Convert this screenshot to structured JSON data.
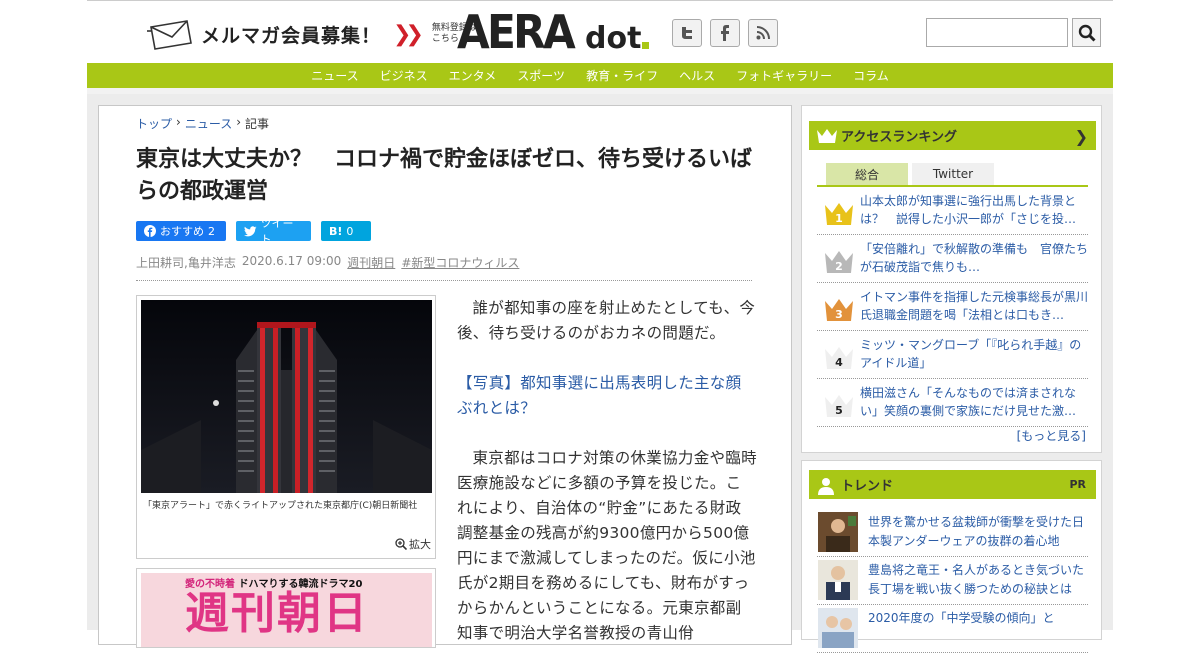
{
  "header": {
    "mailmag_label": "メルマガ会員募集！",
    "free_line1": "無料登録は",
    "free_line2": "こちら",
    "logo_main": "AERA",
    "logo_sub": "dot",
    "social_icons": [
      "twitter-icon",
      "facebook-icon",
      "rss-icon"
    ],
    "search_placeholder": ""
  },
  "nav": [
    "ニュース",
    "ビジネス",
    "エンタメ",
    "スポーツ",
    "教育・ライフ",
    "ヘルス",
    "フォトギャラリー",
    "コラム"
  ],
  "colors": {
    "accent": "#a9c716",
    "link": "#2b5ca6",
    "facebook": "#1877f2",
    "twitter": "#1da1f2",
    "hatena": "#00a4de"
  },
  "breadcrumb": {
    "home": "トップ",
    "section": "ニュース",
    "current": "記事"
  },
  "article": {
    "title": "東京は大丈夫か？　コロナ禍で貯金ほぼゼロ、待ち受けるいばらの都政運営",
    "share_fb_label": "おすすめ",
    "share_fb_count": "2",
    "share_tw_label": "ツイート",
    "share_hb_label": "B!",
    "share_hb_count": "0",
    "authors": "上田耕司,亀井洋志",
    "date": "2020.6.17 09:00",
    "source": "週刊朝日",
    "tag": "#新型コロナウィルス",
    "photo_caption": "「東京アラート」で赤くライトアップされた東京都庁(C)朝日新聞社",
    "zoom_label": "拡大",
    "magazine_top": "愛の不時着",
    "magazine_top2": "ドハマりする韓流ドラマ20",
    "magazine_title": "週刊朝日",
    "para1": "誰が都知事の座を射止めたとしても、今後、待ち受けるのがおカネの問題だ。",
    "photo_link": "【写真】都知事選に出馬表明した主な顔ぶれとは？",
    "para2": "東京都はコロナ対策の休業協力金や臨時医療施設などに多額の予算を投じた。これにより、自治体の“貯金”にあたる財政調整基金の残高が約9300億円から500億円にまで激減してしまったのだ。仮に小池氏が2期目を務めるにしても、財布がすっからかんということになる。元東京都副知事で明治大学名誉教授の青山佾"
  },
  "ranking": {
    "title": "アクセスランキング",
    "tabs": [
      "総合",
      "Twitter"
    ],
    "items": [
      {
        "rank": "1",
        "text": "山本太郎が知事選に強行出馬した背景とは？　説得した小沢一郎が「さじを投…"
      },
      {
        "rank": "2",
        "text": "「安倍離れ」で秋解散の準備も　官僚たちが石破茂詣で焦りも…"
      },
      {
        "rank": "3",
        "text": "イトマン事件を指揮した元検事総長が黒川氏退職金問題を喝「法相とは口もき…"
      },
      {
        "rank": "4",
        "text": "ミッツ・マングローブ「『叱られ手越』のアイドル道」"
      },
      {
        "rank": "5",
        "text": "横田滋さん「そんなものでは済まされない」笑顔の裏側で家族にだけ見せた激…"
      }
    ],
    "more": "[もっと見る]"
  },
  "trend": {
    "title": "トレンド",
    "pr": "PR",
    "items": [
      {
        "text": "世界を驚かせる盆栽師が衝撃を受けた日本製アンダーウェアの抜群の着心地"
      },
      {
        "text": "豊島将之竜王・名人があるとき気づいた長丁場を戦い抜く勝つための秘訣とは"
      },
      {
        "text": "2020年度の「中学受験の傾向」と"
      }
    ]
  }
}
